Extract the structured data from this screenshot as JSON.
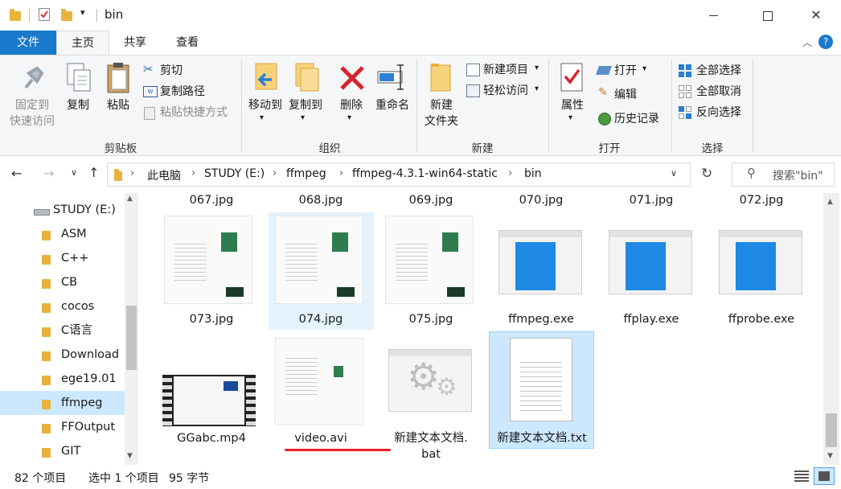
{
  "window": {
    "title": "bin"
  },
  "tabs": [
    {
      "label": "文件"
    },
    {
      "label": "主页"
    },
    {
      "label": "共享"
    },
    {
      "label": "查看"
    }
  ],
  "ribbon": {
    "clipboard": {
      "pin_line1": "固定到",
      "pin_line2": "快速访问",
      "copy": "复制",
      "paste": "粘贴",
      "cut": "剪切",
      "copy_path": "复制路径",
      "paste_shortcut": "粘贴快捷方式",
      "group": "剪贴板"
    },
    "organize": {
      "move_to": "移动到",
      "copy_to": "复制到",
      "delete": "删除",
      "rename": "重命名",
      "group": "组织"
    },
    "new": {
      "new_folder_line1": "新建",
      "new_folder_line2": "文件夹",
      "new_item": "新建项目",
      "easy_access": "轻松访问",
      "group": "新建"
    },
    "open": {
      "properties": "属性",
      "open": "打开",
      "edit": "编辑",
      "history": "历史记录",
      "group": "打开"
    },
    "select": {
      "select_all": "全部选择",
      "select_none": "全部取消",
      "invert": "反向选择",
      "group": "选择"
    }
  },
  "address": {
    "crumbs": [
      "此电脑",
      "STUDY (E:)",
      "ffmpeg",
      "ffmpeg-4.3.1-win64-static",
      "bin"
    ],
    "search_placeholder": "搜索\"bin\""
  },
  "nav": {
    "items": [
      "STUDY (E:)",
      "ASM",
      "C++",
      "CB",
      "cocos",
      "C语言",
      "Download",
      "ege19.01",
      "ffmpeg",
      "FFOutput",
      "GIT"
    ],
    "selected": "ffmpeg"
  },
  "files": {
    "top_row": [
      "067.jpg",
      "068.jpg",
      "069.jpg",
      "070.jpg",
      "071.jpg",
      "072.jpg"
    ],
    "row2": [
      "073.jpg",
      "074.jpg",
      "075.jpg",
      "ffmpeg.exe",
      "ffplay.exe",
      "ffprobe.exe"
    ],
    "row3": [
      "GGabc.mp4",
      "video.avi",
      "新建文本文档.",
      "bat",
      "新建文本文档.txt"
    ]
  },
  "status": {
    "count": "82 个项目",
    "selection": "选中 1 个项目",
    "size": "95 字节"
  },
  "colors": {
    "accent": "#1979ca",
    "selected_bg": "#cce8ff",
    "underline": "#e8202a"
  }
}
